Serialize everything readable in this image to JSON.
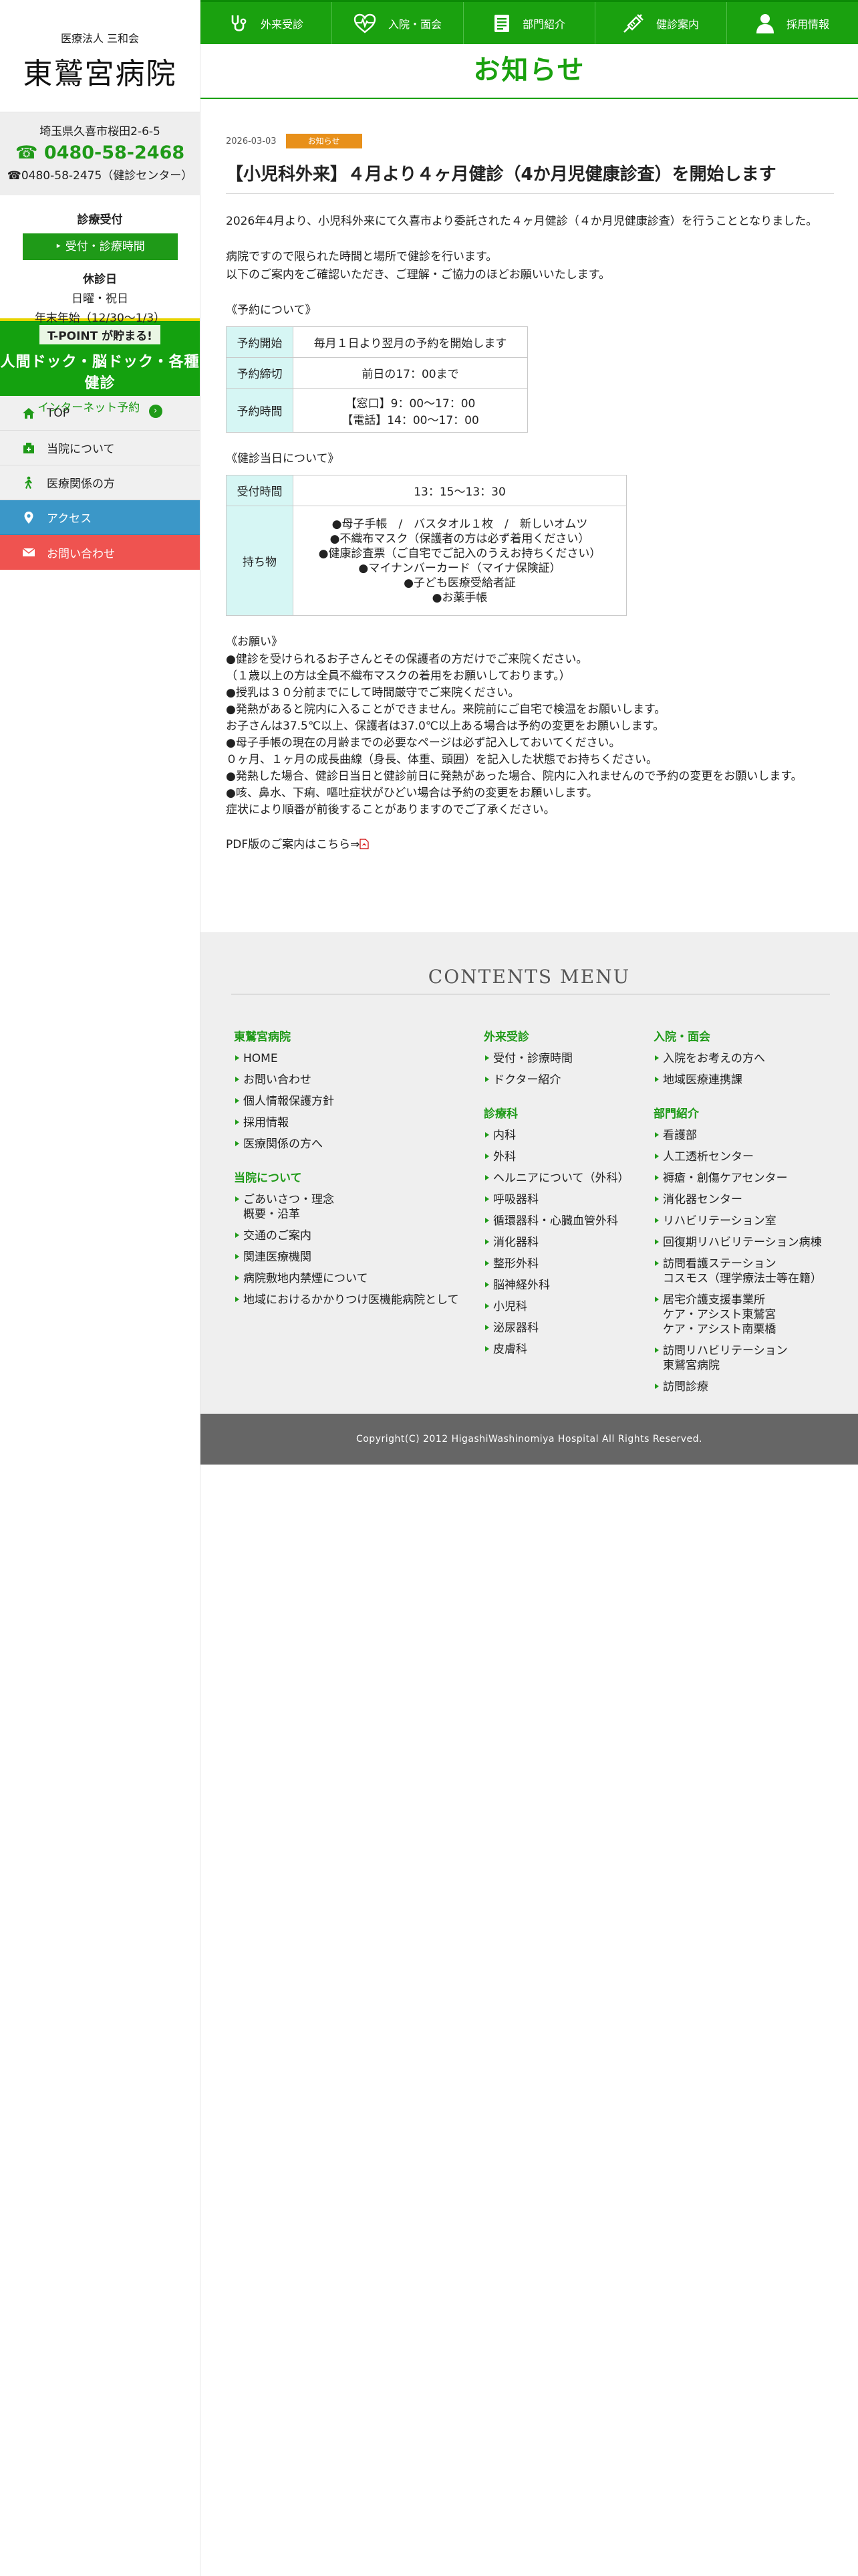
{
  "hospital": {
    "sub_name": "医療法人 三和会",
    "name": "東鷲宮病院",
    "address": "埼玉県久喜市桜田2-6-5",
    "tel_main": "☎ 0480-58-2468",
    "tel_sub": "☎0480-58-2475（健診センター）"
  },
  "hours": {
    "title": "診療受付",
    "button": "‣ 受付・診療時間",
    "closed_title": "休診日",
    "closed_line1": "日曜・祝日",
    "closed_line2": "年末年始（12/30〜1/3）"
  },
  "tpoint": {
    "top": "T-POINT が貯まる!",
    "main": "人間ドック・脳ドック・各種健診",
    "button": "インターネット予約"
  },
  "sidenav": [
    {
      "label": "TOP"
    },
    {
      "label": "当院について"
    },
    {
      "label": "医療関係の方"
    },
    {
      "label": "アクセス"
    },
    {
      "label": "お問い合わせ"
    }
  ],
  "topnav": [
    {
      "label": "外来受診"
    },
    {
      "label": "入院・面会"
    },
    {
      "label": "部門紹介"
    },
    {
      "label": "健診案内"
    },
    {
      "label": "採用情報"
    }
  ],
  "page_title": "お知らせ",
  "article": {
    "date": "2026-03-03",
    "badge": "お知らせ",
    "title": "【小児科外来】４月より４ヶ月健診（4か月児健康診査）を開始します",
    "intro": "2026年4月より、小児科外来にて久喜市より委託された４ヶ月健診（４か月児健康診査）を行うこととなりました。",
    "para2_line1": "病院ですので限られた時間と場所で健診を行います。",
    "para2_line2": "以下のご案内をご確認いただき、ご理解・ご協力のほどお願いいたします。",
    "reserve_heading": "《予約について》",
    "reserve_table": {
      "start_label": "予約開始",
      "start_value": "毎月１日より翌月の予約を開始します",
      "deadline_label": "予約締切",
      "deadline_value": "前日の17：00まで",
      "time_label": "予約時間",
      "time_value1": "【窓口】9：00〜17：00",
      "time_value2": "【電話】14：00〜17：00"
    },
    "day_heading": "《健診当日について》",
    "day_table": {
      "reception_label": "受付時間",
      "reception_value": "13：15〜13：30",
      "items_label": "持ち物",
      "items": [
        "●母子手帳　/　バスタオル１枚　/　新しいオムツ",
        "●不織布マスク（保護者の方は必ず着用ください）",
        "●健康診査票（ご自宅でご記入のうえお持ちください）",
        "●マイナンバーカード（マイナ保険証）",
        "●子ども医療受給者証",
        "●お薬手帳"
      ]
    },
    "request_heading": "《お願い》",
    "requests": [
      "●健診を受けられるお子さんとその保護者の方だけでご来院ください。",
      "（１歳以上の方は全員不織布マスクの着用をお願いしております。）",
      "●授乳は３０分前までにして時間厳守でご来院ください。",
      "●発熱があると院内に入ることができません。来院前にご自宅で検温をお願いします。",
      "お子さんは37.5℃以上、保護者は37.0℃以上ある場合は予約の変更をお願いします。",
      "●母子手帳の現在の月齢までの必要なページは必ず記入しておいてください。",
      "０ヶ月、１ヶ月の成長曲線（身長、体重、頭囲）を記入した状態でお持ちください。",
      "●発熱した場合、健診日当日と健診前日に発熱があった場合、院内に入れませんので予約の変更をお願いします。",
      "●咳、鼻水、下痢、嘔吐症状がひどい場合は予約の変更をお願いします。",
      "症状により順番が前後することがありますのでご了承ください。"
    ],
    "pdf_text": "PDF版のご案内はこちら⇒"
  },
  "footer": {
    "menu_title": "CONTENTS MENU",
    "col1": {
      "head1": "東鷲宮病院",
      "links1": [
        "HOME",
        "お問い合わせ",
        "個人情報保護方針",
        "採用情報",
        "医療関係の方へ"
      ],
      "head2": "当院について",
      "links2": [
        "ごあいさつ・理念\n概要・沿革",
        "交通のご案内",
        "関連医療機関",
        "病院敷地内禁煙について",
        "地域におけるかかりつけ医機能病院として"
      ]
    },
    "col2": {
      "head1": "外来受診",
      "links1": [
        "受付・診療時間",
        "ドクター紹介"
      ],
      "head2": "診療科",
      "links2": [
        "内科",
        "外科",
        "ヘルニアについて（外科）",
        "呼吸器科",
        "循環器科・心臓血管外科",
        "消化器科",
        "整形外科",
        "脳神経外科",
        "小児科",
        "泌尿器科",
        "皮膚科"
      ]
    },
    "col3": {
      "head1": "入院・面会",
      "links1": [
        "入院をお考えの方へ",
        "地域医療連携課"
      ],
      "head2": "部門紹介",
      "links2": [
        "看護部",
        "人工透析センター",
        "褥瘡・創傷ケアセンター",
        "消化器センター",
        "リハビリテーション室",
        "回復期リハビリテーション病棟",
        "訪問看護ステーション\nコスモス（理学療法士等在籍）",
        "居宅介護支援事業所\nケア・アシスト東鷲宮\nケア・アシスト南栗橋",
        "訪問リハビリテーション\n東鷲宮病院",
        "訪問診療"
      ]
    },
    "copyright": "Copyright(C) 2012 HigashiWashinomiya Hospital All Rights Reserved."
  },
  "colors": {
    "brand_green": "#1aa10f",
    "access_blue": "#3b97c8",
    "contact_red": "#ef5350",
    "badge_orange": "#e8901a",
    "table_header": "#d6f6f4"
  }
}
